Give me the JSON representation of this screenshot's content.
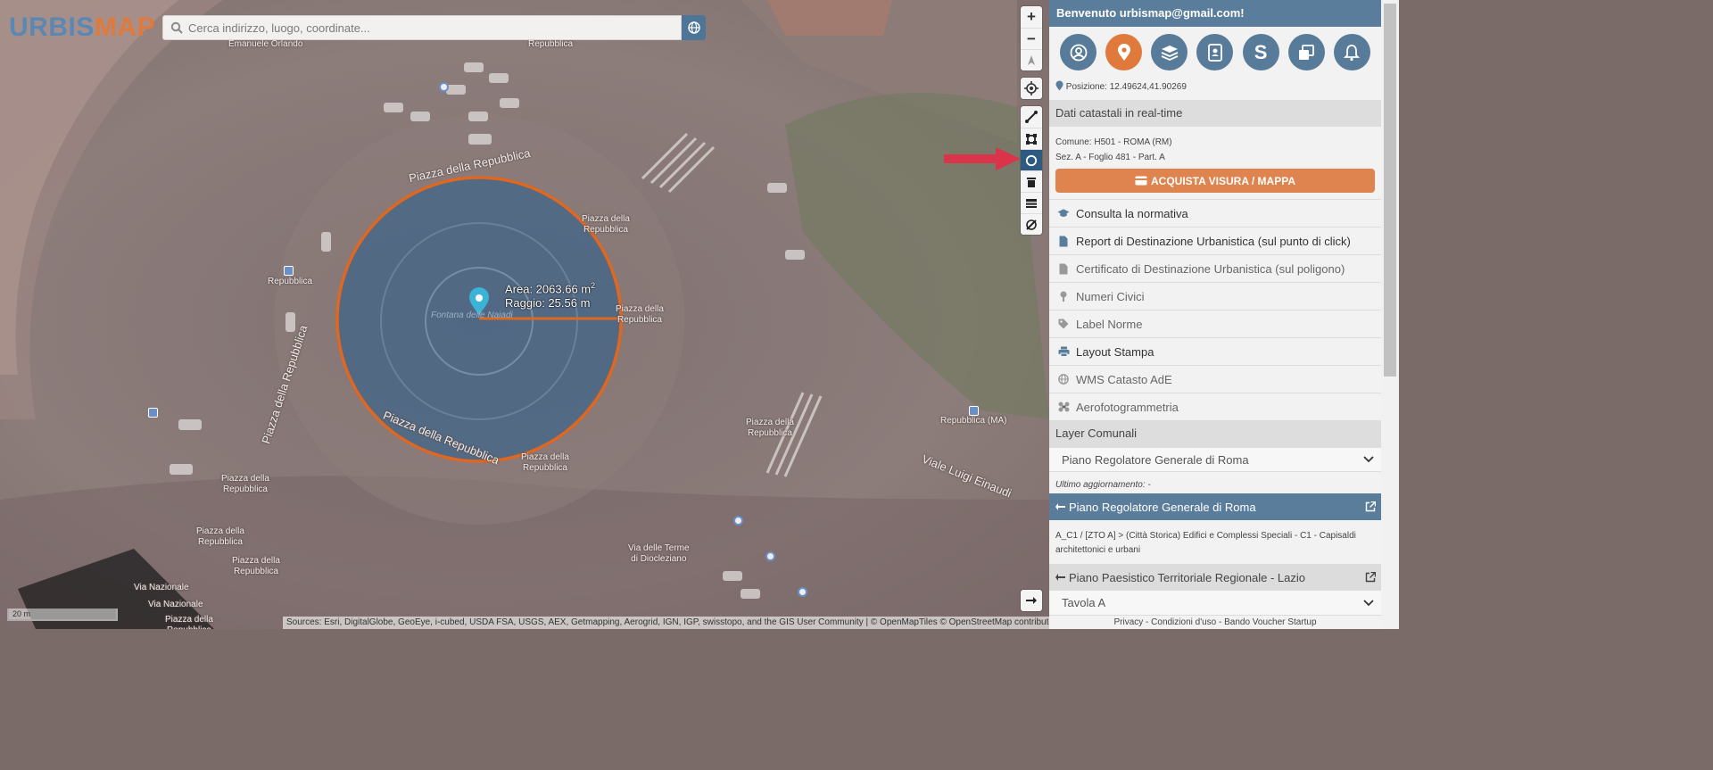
{
  "logo": {
    "part1": "URBIS",
    "part2": "MAP"
  },
  "search": {
    "placeholder": "Cerca indirizzo, luogo, coordinate...",
    "icon": "search-icon"
  },
  "map": {
    "labels": [
      {
        "text": "Emanuele Orlando"
      },
      {
        "text": "Repubblica"
      },
      {
        "text": "Piazza della Repubblica"
      },
      {
        "text": "Piazza della\nRepubblica"
      },
      {
        "text": "Piazza della\nRepubblica"
      },
      {
        "text": "Repubblica"
      },
      {
        "text": "Piazza della Repubblica"
      },
      {
        "text": "Piazza della Repubblica"
      },
      {
        "text": "Fontana delle Naiadi"
      },
      {
        "text": "Piazza della\nRepubblica"
      },
      {
        "text": "Piazza della\nRepubblica"
      },
      {
        "text": "Piazza della\nRepubblica"
      },
      {
        "text": "Piazza della\nRepubblica"
      },
      {
        "text": "Piazza della\nRepubblica"
      },
      {
        "text": "Repubblica (MA)"
      },
      {
        "text": "Viale Luigi Einaudi"
      },
      {
        "text": "Via delle Terme\ndi Diocleziano"
      },
      {
        "text": "Via Nazionale"
      },
      {
        "text": "Via Nazionale"
      },
      {
        "text": "Piazza della\nRepubblica"
      }
    ],
    "measure": {
      "area_label": "Area: 2063.66 m",
      "area_sup": "2",
      "radius_label": "Raggio: 25.56 m"
    },
    "scale": "20 m",
    "attribution": "Sources: Esri, DigitalGlobe, GeoEye, i-cubed, USDA FSA, USGS, AEX, Getmapping, Aerogrid, IGN, IGP, swisstopo, and the GIS User Community | © OpenMapTiles © OpenStreetMap contributors",
    "colors": {
      "circle_fill": "#2f5f8e",
      "circle_stroke": "#e0671f",
      "arrow": "#d9344a",
      "marker": "#3bb3d6"
    }
  },
  "toolbar": {
    "zoom_in": "+",
    "zoom_out": "−",
    "tools": [
      "polyline-icon",
      "polygon-icon",
      "circle-icon",
      "trash-icon",
      "layers-stack-icon",
      "no-edit-icon"
    ]
  },
  "sidebar": {
    "welcome": "Benvenuto urbismap@gmail.com!",
    "icons": [
      "user-icon",
      "map-pin-icon",
      "layers-icon",
      "contact-card-icon",
      "s-icon",
      "windows-icon",
      "bell-icon"
    ],
    "position": "Posizione: 12.49624,41.90269",
    "cadastral_title": "Dati catastali in real-time",
    "comune": "Comune: H501 - ROMA (RM)",
    "sezione": "Sez. A - Foglio 481 - Part. A",
    "buy_button": "ACQUISTA VISURA / MAPPA",
    "menu": [
      {
        "label": "Consulta la normativa",
        "icon": "graduation-cap-icon"
      },
      {
        "label": "Report di Destinazione Urbanistica (sul punto di click)",
        "icon": "file-icon"
      },
      {
        "label": "Certificato di Destinazione Urbanistica (sul poligono)",
        "icon": "file-icon"
      },
      {
        "label": "Numeri Civici",
        "icon": "pin-icon"
      },
      {
        "label": "Label Norme",
        "icon": "tag-icon"
      },
      {
        "label": "Layout Stampa",
        "icon": "print-icon"
      },
      {
        "label": "WMS Catasto AdE",
        "icon": "globe-icon"
      },
      {
        "label": "Aerofotogrammetria",
        "icon": "drone-icon"
      }
    ],
    "layer_title": "Layer Comunali",
    "layer_select": "Piano Regolatore Generale di Roma",
    "last_update": "Ultimo aggiornamento: -",
    "prg_bar": "Piano Regolatore Generale di Roma",
    "zto_text": "A_C1 / [ZTO A] > (Città Storica) Edifici e Complessi Speciali - C1 - Capisaldi architettonici e urbani",
    "ptpr_bar": "Piano Paesistico Territoriale Regionale - Lazio",
    "tavola_select": "Tavola A",
    "footer": "Privacy - Condizioni d'uso - Bando Voucher Startup"
  }
}
